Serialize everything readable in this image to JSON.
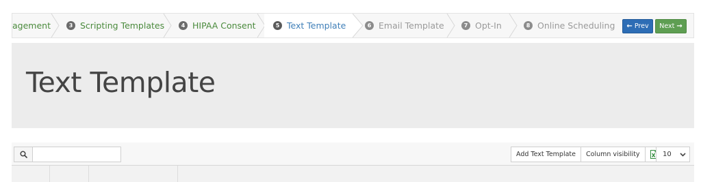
{
  "wizard": {
    "steps": [
      {
        "num": "",
        "label": "agement",
        "state": "done"
      },
      {
        "num": "3",
        "label": "Scripting Templates",
        "state": "done"
      },
      {
        "num": "4",
        "label": "HIPAA Consent",
        "state": "done"
      },
      {
        "num": "5",
        "label": "Text Template",
        "state": "current"
      },
      {
        "num": "6",
        "label": "Email Template",
        "state": "todo"
      },
      {
        "num": "7",
        "label": "Opt-In",
        "state": "todo"
      },
      {
        "num": "8",
        "label": "Online Scheduling",
        "state": "todo"
      }
    ],
    "prev_label": "Prev",
    "next_label": "Next"
  },
  "page": {
    "title": "Text Template"
  },
  "toolbar": {
    "search_value": "",
    "add_label": "Add Text Template",
    "column_visibility_label": "Column visibility",
    "page_size": "10"
  },
  "colors": {
    "done": "#4a8a3c",
    "current": "#3f7fb8",
    "todo": "#9a9a9a",
    "prev_button": "#2d6db5",
    "next_button": "#5e9e52"
  },
  "icons": {
    "search": "search-icon",
    "excel": "excel-icon",
    "page_size_chevron": "chevron-down-icon",
    "prev_arrow": "arrow-left-icon",
    "next_arrow": "arrow-right-icon"
  }
}
